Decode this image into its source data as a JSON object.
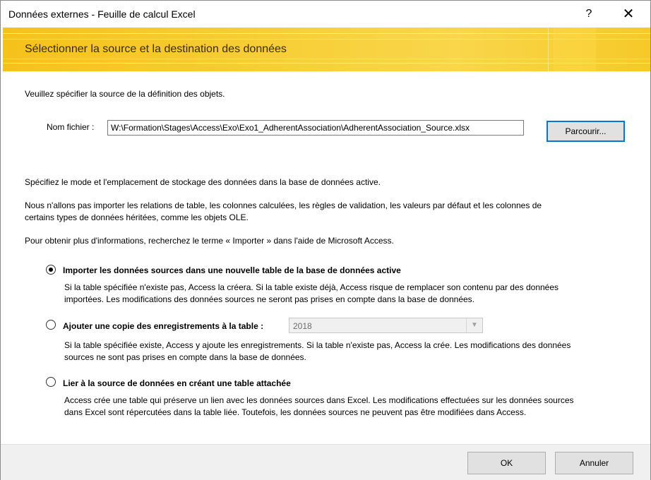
{
  "window": {
    "title": "Données externes - Feuille de calcul Excel",
    "help_label": "?",
    "close_label": "✕"
  },
  "banner": {
    "title": "Sélectionner la source et la destination des données"
  },
  "source": {
    "instruction": "Veuillez spécifier la source de la définition des objets.",
    "file_label": "Nom fichier :",
    "file_value": "W:\\Formation\\Stages\\Access\\Exo\\Exo1_AdherentAssociation\\AdherentAssociation_Source.xlsx",
    "browse_label": "Parcourir..."
  },
  "info": {
    "mode_text": "Spécifiez le mode et l'emplacement de stockage des données dans la base de données active.",
    "not_imported_line1": "Nous n'allons pas importer les relations de table, les colonnes calculées, les règles de validation, les valeurs par défaut et les colonnes de",
    "not_imported_line2": "certains types de données héritées, comme les objets OLE.",
    "help_text": "Pour obtenir plus d'informations, recherchez le terme « Importer » dans l'aide de Microsoft Access."
  },
  "options": [
    {
      "label": "Importer les données sources dans une nouvelle table de la base de données active",
      "selected": true,
      "desc_line1": "Si la table spécifiée n'existe pas, Access la créera. Si la table existe déjà, Access risque de remplacer son contenu par des données",
      "desc_line2": "importées. Les modifications des données sources ne seront pas prises en compte dans la base de données."
    },
    {
      "label": "Ajouter une copie des enregistrements à la table :",
      "selected": false,
      "table_value": "2018",
      "desc_line1": "Si la table spécifiée existe, Access y ajoute les enregistrements. Si la table n'existe pas, Access la crée. Les modifications des données",
      "desc_line2": "sources ne sont pas prises en compte dans la base de données."
    },
    {
      "label": "Lier à la source de données en créant une table attachée",
      "selected": false,
      "desc_line1": "Access crée une table qui préserve un lien avec les données sources dans Excel. Les modifications effectuées sur les données sources",
      "desc_line2": "dans Excel sont répercutées dans la table liée. Toutefois, les données sources ne peuvent pas être modifiées dans Access."
    }
  ],
  "footer": {
    "ok_label": "OK",
    "cancel_label": "Annuler"
  }
}
